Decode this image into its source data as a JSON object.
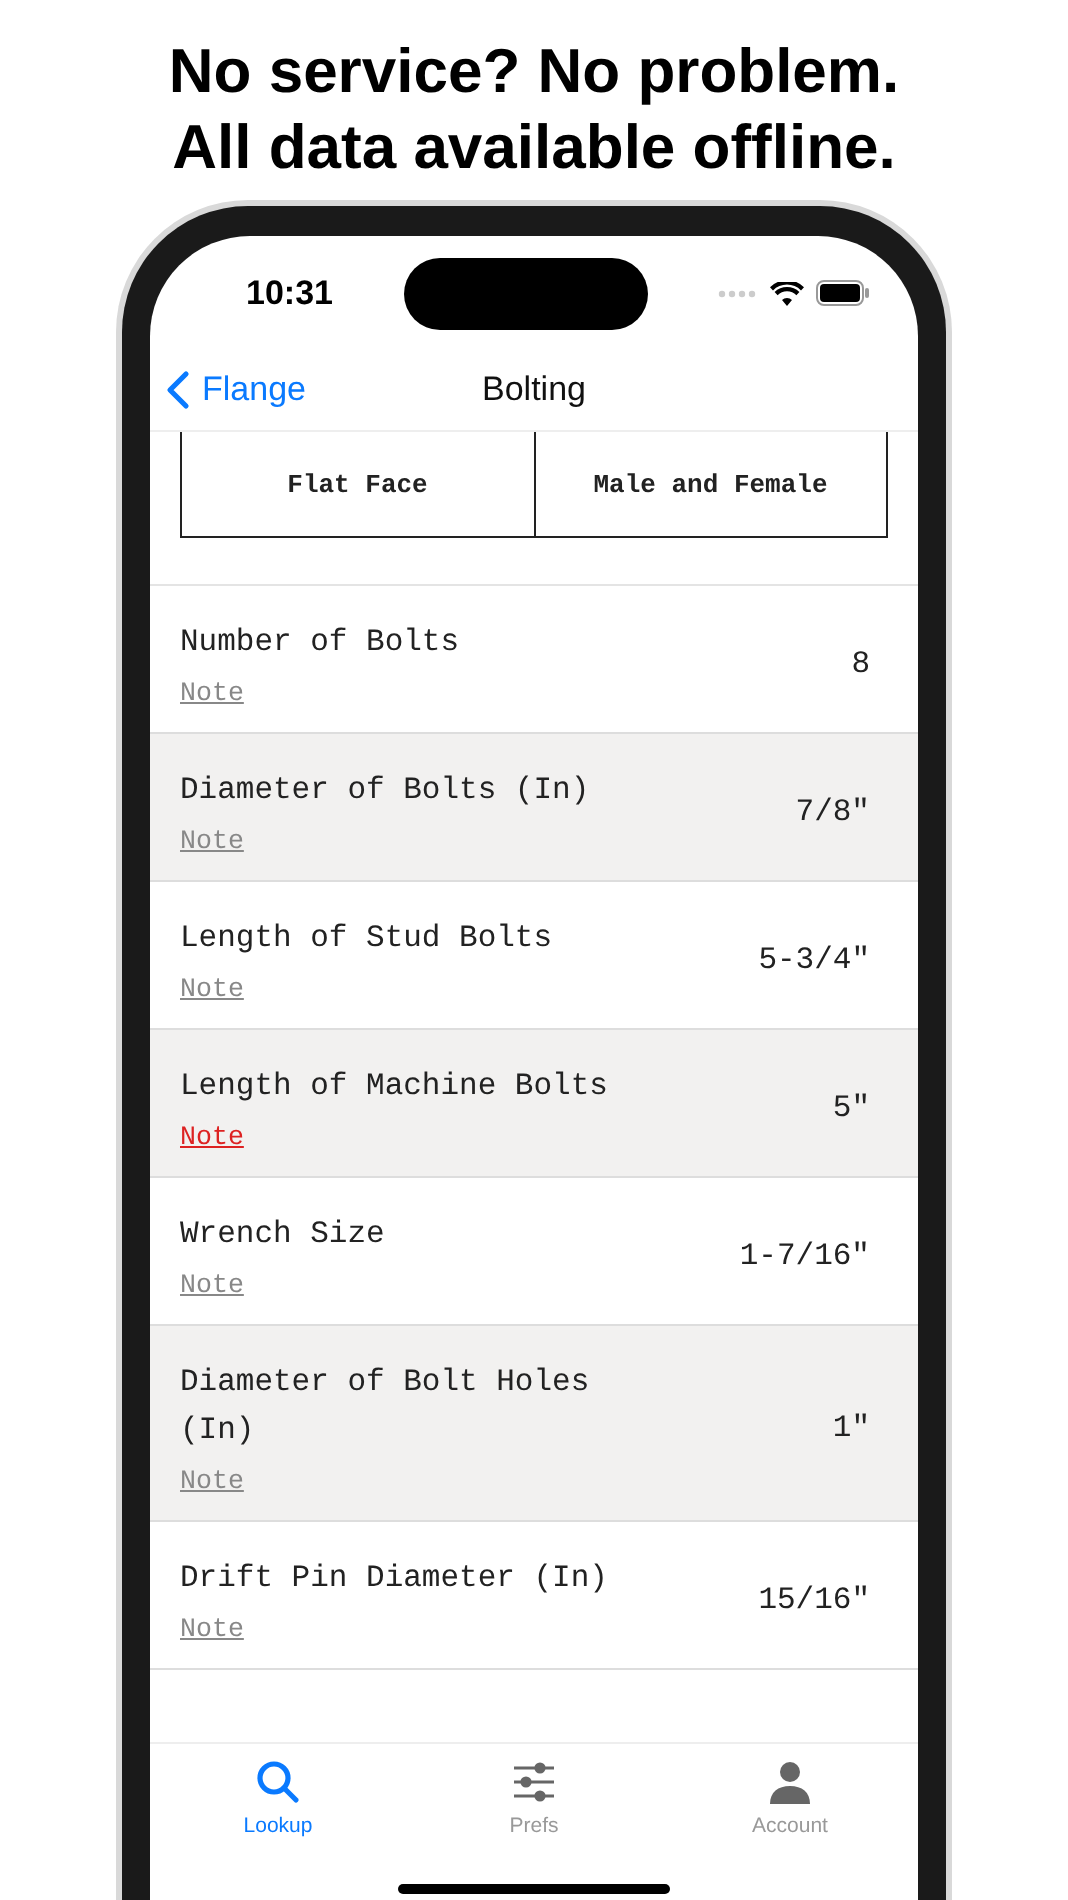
{
  "headline": [
    "No service? No problem.",
    "All data available offline."
  ],
  "status_bar": {
    "time": "10:31"
  },
  "nav": {
    "back": "Flange",
    "title": "Bolting"
  },
  "segments": [
    {
      "label": "Flat Face"
    },
    {
      "label": "Male and Female"
    }
  ],
  "rows": [
    {
      "label": "Number of Bolts",
      "value": "8",
      "note": "Note",
      "flagged": false
    },
    {
      "label": "Diameter of Bolts (In)",
      "value": "7/8\"",
      "note": "Note",
      "flagged": false
    },
    {
      "label": "Length of Stud Bolts",
      "value": "5-3/4\"",
      "note": "Note",
      "flagged": false
    },
    {
      "label": "Length of Machine Bolts",
      "value": "5\"",
      "note": "Note",
      "flagged": true
    },
    {
      "label": "Wrench Size",
      "value": "1-7/16\"",
      "note": "Note",
      "flagged": false
    },
    {
      "label": "Diameter of Bolt Holes (In)",
      "value": "1\"",
      "note": "Note",
      "flagged": false
    },
    {
      "label": "Drift Pin Diameter (In)",
      "value": "15/16\"",
      "note": "Note",
      "flagged": false
    }
  ],
  "tabs": [
    {
      "label": "Lookup",
      "kind": "search",
      "selected": true
    },
    {
      "label": "Prefs",
      "kind": "sliders",
      "selected": false
    },
    {
      "label": "Account",
      "kind": "person",
      "selected": false
    }
  ]
}
